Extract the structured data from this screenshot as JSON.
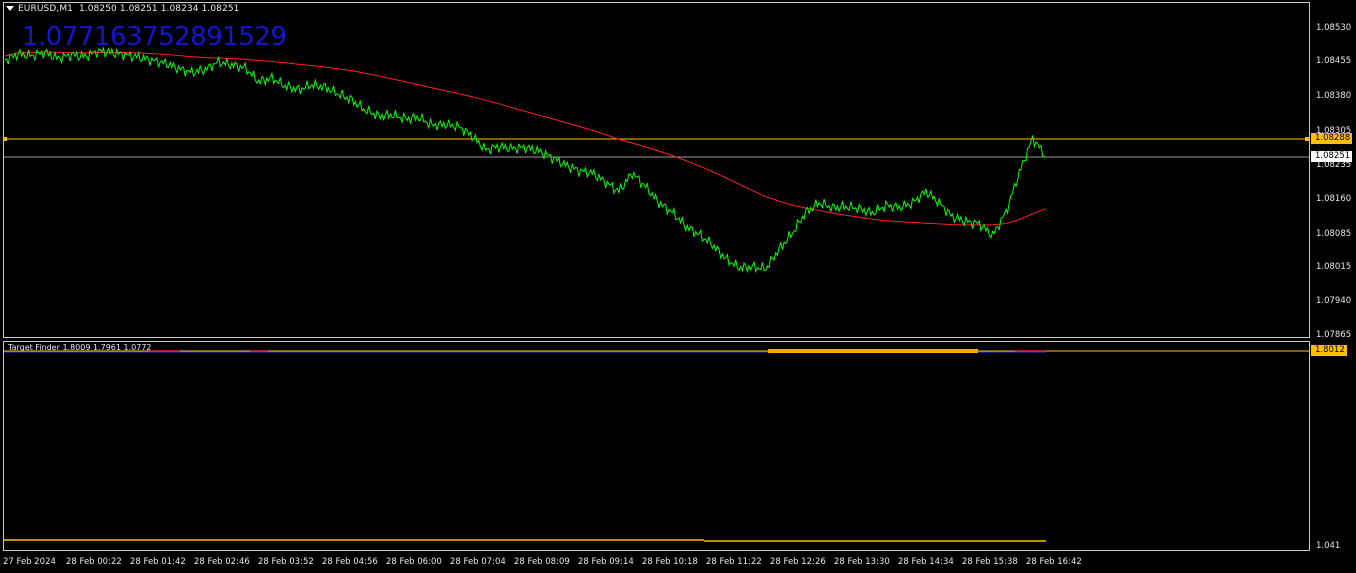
{
  "header": {
    "symbol": "EURUSD,M1",
    "ohlc": "1.08250 1.08251 1.08234 1.08251"
  },
  "overlay_value": "1.077163752891529",
  "indicator": {
    "title": "Target Finder 1.8009 1.7961 1.0772",
    "price_tag": "1.8012",
    "bottom_label": "1.041"
  },
  "price_axis": {
    "labels": [
      "1.08530",
      "1.08455",
      "1.08380",
      "1.08305",
      "1.08235",
      "1.08160",
      "1.08085",
      "1.08015",
      "1.07940",
      "1.07865"
    ],
    "current_tag": "1.08251",
    "level_tag": "1.08288"
  },
  "time_axis": {
    "labels": [
      "27 Feb 2024",
      "28 Feb 00:22",
      "28 Feb 01:42",
      "28 Feb 02:46",
      "28 Feb 03:52",
      "28 Feb 04:56",
      "28 Feb 06:00",
      "28 Feb 07:04",
      "28 Feb 08:09",
      "28 Feb 09:14",
      "28 Feb 10:18",
      "28 Feb 11:22",
      "28 Feb 12:26",
      "28 Feb 13:30",
      "28 Feb 14:34",
      "28 Feb 15:38",
      "28 Feb 16:42"
    ]
  },
  "colors": {
    "price_line": "#00ff00",
    "moving_average": "#ff2020",
    "level_line": "#ffbf00",
    "overlay_text": "#1414d2",
    "indicator_blue": "#3232ff",
    "indicator_orange": "#ffa500"
  },
  "series": {
    "price_close": [
      1.08458,
      1.08472,
      1.08468,
      1.08475,
      1.08462,
      1.0847,
      1.08466,
      1.08478,
      1.08475,
      1.0847,
      1.08465,
      1.08458,
      1.08452,
      1.0844,
      1.08432,
      1.08438,
      1.08455,
      1.08448,
      1.08442,
      1.08412,
      1.0842,
      1.08402,
      1.08395,
      1.08405,
      1.084,
      1.08385,
      1.08372,
      1.0835,
      1.08338,
      1.0834,
      1.08332,
      1.08335,
      1.08318,
      1.0832,
      1.08315,
      1.08295,
      1.08265,
      1.08272,
      1.08268,
      1.0827,
      1.08262,
      1.08248,
      1.08232,
      1.0822,
      1.08215,
      1.08195,
      1.08175,
      1.08215,
      1.08185,
      1.0815,
      1.0813,
      1.081,
      1.08082,
      1.0806,
      1.0803,
      1.0801,
      1.08012,
      1.08008,
      1.0805,
      1.08085,
      1.0813,
      1.0815,
      1.0814,
      1.08142,
      1.08138,
      1.08128,
      1.08145,
      1.0814,
      1.0815,
      1.08175,
      1.0815,
      1.0812,
      1.0811,
      1.08105,
      1.0808,
      1.0813,
      1.08215,
      1.0829,
      1.0825
    ]
  }
}
